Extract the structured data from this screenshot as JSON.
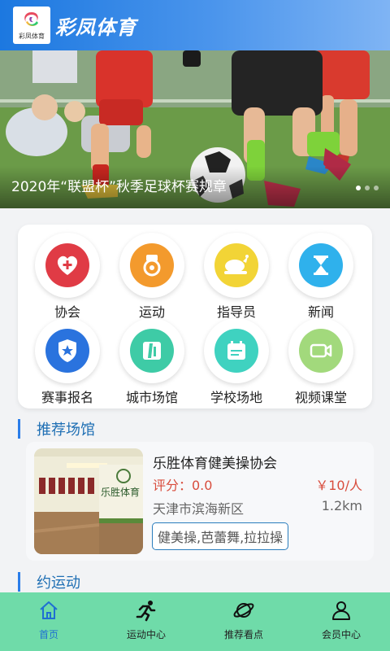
{
  "header": {
    "logo_text": "彩凤体育",
    "title": "彩凤体育"
  },
  "banner": {
    "title": "2020年“联盟杯”秋季足球杯赛规章",
    "slides": 3,
    "active_slide": 1
  },
  "grid": {
    "items": [
      {
        "label": "协会",
        "icon": "heart-plus-icon",
        "color": "#e03b45"
      },
      {
        "label": "运动",
        "icon": "medal-icon",
        "color": "#f39a2d"
      },
      {
        "label": "指导员",
        "icon": "chicken-icon",
        "color": "#f2d436"
      },
      {
        "label": "新闻",
        "icon": "hourglass-icon",
        "color": "#2fb1ec"
      },
      {
        "label": "赛事报名",
        "icon": "shield-star-icon",
        "color": "#2a73de"
      },
      {
        "label": "城市场馆",
        "icon": "road-icon",
        "color": "#3ecba6"
      },
      {
        "label": "学校场地",
        "icon": "calendar-icon",
        "color": "#3fd2c0"
      },
      {
        "label": "视频课堂",
        "icon": "video-camera-icon",
        "color": "#a2d97c"
      }
    ]
  },
  "sections": {
    "recommended": "推荐场馆",
    "activities": "约运动"
  },
  "venue": {
    "name": "乐胜体育健美操协会",
    "rating": "评分：0.0",
    "price": "￥10/人",
    "area": "天津市滨海新区",
    "distance": "1.2km",
    "tags": "健美操,芭蕾舞,拉拉操",
    "sign_text": "乐胜体育"
  },
  "nav": {
    "items": [
      {
        "label": "首页",
        "icon": "home-icon",
        "active": true
      },
      {
        "label": "运动中心",
        "icon": "runner-icon",
        "active": false
      },
      {
        "label": "推荐看点",
        "icon": "planet-icon",
        "active": false
      },
      {
        "label": "会员中心",
        "icon": "user-icon",
        "active": false
      }
    ]
  },
  "colors": {
    "header": "#1c78e0",
    "accent": "#1f6fb4",
    "price": "#d84d3d",
    "nav_bg": "#6fdba9",
    "nav_active": "#1f6fd2"
  }
}
